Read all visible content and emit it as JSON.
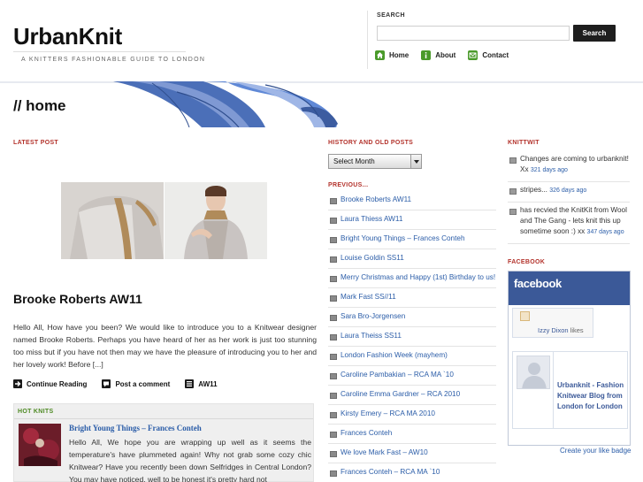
{
  "site": {
    "title": "UrbanKnit",
    "tagline": "A KNITTERS FASHIONABLE GUIDE TO LONDON"
  },
  "search": {
    "label": "SEARCH",
    "value": "",
    "placeholder": "",
    "button": "Search"
  },
  "nav": {
    "items": [
      {
        "label": "Home",
        "icon": "home-icon"
      },
      {
        "label": "About",
        "icon": "info-icon"
      },
      {
        "label": "Contact",
        "icon": "mail-icon"
      }
    ]
  },
  "page": {
    "title": "// home"
  },
  "latest": {
    "heading": "LATEST POST",
    "post_title": "Brooke Roberts AW11",
    "excerpt": "Hello All, How have you been? We would like to introduce you to a Knitwear designer named Brooke Roberts. Perhaps you have heard of her as her work is just too stunning too miss but if you have not then may we have the pleasure of introducing you to her and her lovely work! Before [...]",
    "meta": {
      "continue": "Continue Reading",
      "comment": "Post a comment",
      "category": "AW11"
    }
  },
  "hotknits": {
    "heading": "HOT KNITS",
    "title": "Bright Young Things – Frances Conteh",
    "text": "Hello All, We hope you are wrapping up well as it seems the temperature's have plummeted again! Why not grab some cozy chic Knitwear? Have you recently been down Selfridges in Central London? You may have noticed, well to be honest it's pretty hard not"
  },
  "archive": {
    "heading": "HISTORY AND OLD POSTS",
    "select_label": "Select Month",
    "previous_heading": "PREVIOUS...",
    "previous": [
      "Brooke Roberts AW11",
      "Laura Thiess AW11",
      "Bright Young Things – Frances Conteh",
      "Louise Goldin SS11",
      "Merry Christmas and Happy (1st) Birthday to us!",
      "Mark Fast SS//11",
      "Sara Bro-Jorgensen",
      "Laura Theiss SS11",
      "London Fashion Week (mayhem)",
      "Caroline Pambakian – RCA MA `10",
      "Caroline Emma Gardner – RCA 2010",
      "Kirsty Emery – RCA MA 2010",
      "Frances Conteh",
      "We love Mark Fast – AW10",
      "Frances Conteh – RCA MA `10"
    ]
  },
  "knittwit": {
    "heading": "KNITTWIT",
    "tweets": [
      {
        "text": "Changes are coming to urbanknit! Xx",
        "ago": "321 days ago"
      },
      {
        "text": "stripes...",
        "ago": "326 days ago"
      },
      {
        "text": "has recvied the KnitKit from Wool and The Gang - lets knit this up sometime soon :) xx",
        "ago": "347 days ago"
      }
    ]
  },
  "facebook": {
    "heading": "FACEBOOK",
    "logo": "facebook",
    "liker_name": "Izzy Dixon",
    "liker_suffix": " likes",
    "page_name": "Urbanknit - Fashion Knitwear Blog from London for London",
    "create_link": "Create your like badge",
    "brand_color": "#3b5998"
  },
  "colors": {
    "accent_red": "#b3322b",
    "link_blue": "#2b5da8",
    "hot_green": "#4e8a24"
  }
}
